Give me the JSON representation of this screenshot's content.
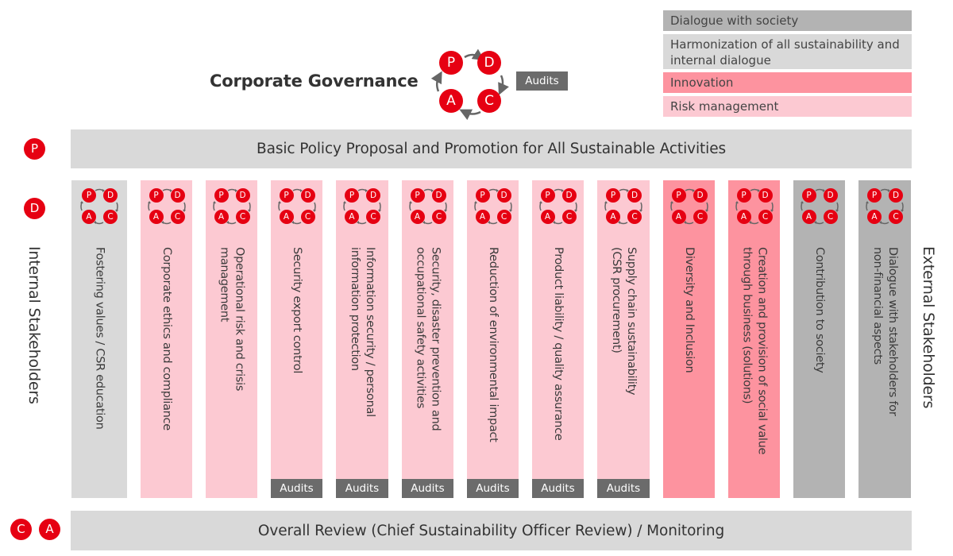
{
  "header": {
    "title": "Corporate Governance",
    "cycle": [
      "P",
      "D",
      "C",
      "A"
    ],
    "audits_label": "Audits"
  },
  "legend": [
    {
      "label": "Dialogue with society",
      "color": "#b3b3b3"
    },
    {
      "label": "Harmonization of all sustainability and internal dialogue",
      "color": "#d9d9d9"
    },
    {
      "label": "Innovation",
      "color": "#fd939f"
    },
    {
      "label": "Risk management",
      "color": "#fcc9d2"
    }
  ],
  "stages": {
    "plan": {
      "letter": "P",
      "label": "Basic Policy Proposal and Promotion for All Sustainable Activities"
    },
    "do": {
      "letter": "D"
    },
    "check_act": {
      "letters": [
        "C",
        "A"
      ],
      "label": "Overall Review (Chief Sustainability Officer Review) / Monitoring"
    }
  },
  "side_labels": {
    "internal": "Internal Stakeholders",
    "external": "External Stakeholders"
  },
  "colors": {
    "pdca_red": "#e60012",
    "dialogue_society": "#b3b3b3",
    "harmonization": "#d9d9d9",
    "innovation": "#fd939f",
    "risk": "#fcc9d2",
    "audits_bg": "#6b6b6b"
  },
  "columns": [
    {
      "label": "Fostering values / CSR education",
      "category": "harmonization",
      "audits": false
    },
    {
      "label": "Corporate ethics and compliance",
      "category": "risk",
      "audits": false
    },
    {
      "label": "Operational risk and crisis\nmanagement",
      "category": "risk",
      "audits": false
    },
    {
      "label": "Security export control",
      "category": "risk",
      "audits": true
    },
    {
      "label": "Information security / personal\ninformation protection",
      "category": "risk",
      "audits": true
    },
    {
      "label": "Security, disaster prevention and\noccupational safety activities",
      "category": "risk",
      "audits": true
    },
    {
      "label": "Reduction of environmental impact",
      "category": "risk",
      "audits": true
    },
    {
      "label": "Product liability / quality assurance",
      "category": "risk",
      "audits": true
    },
    {
      "label": "Supply chain sustainability\n(CSR procurement)",
      "category": "risk",
      "audits": true
    },
    {
      "label": "Diversity and Inclusion",
      "category": "innovation",
      "audits": false
    },
    {
      "label": "Creation and provision of social value\nthrough business (solutions)",
      "category": "innovation",
      "audits": false
    },
    {
      "label": "Contribution to society",
      "category": "dialogue_society",
      "audits": false
    },
    {
      "label": "Dialogue with stakeholders for\nnon-financial aspects",
      "category": "dialogue_society",
      "audits": false
    }
  ],
  "column_audits_label": "Audits"
}
